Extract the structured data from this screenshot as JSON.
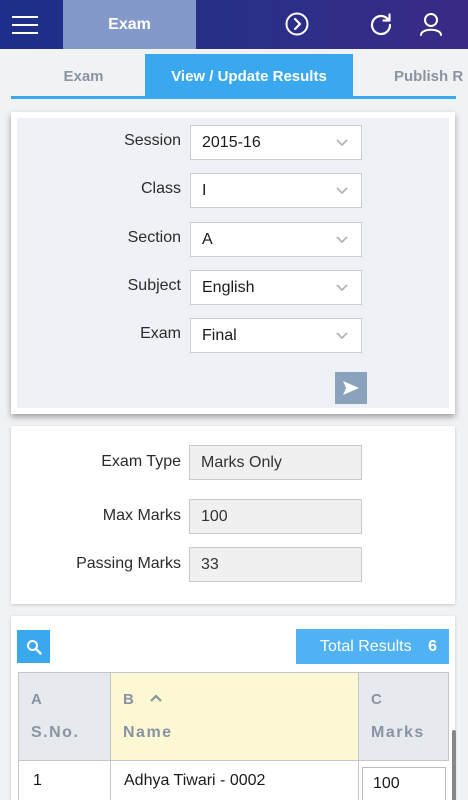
{
  "header": {
    "title": "Exam",
    "icons": [
      "menu-icon",
      "forward-circle-icon",
      "refresh-icon",
      "user-icon"
    ]
  },
  "tabs": [
    {
      "label": "Exam",
      "active": false
    },
    {
      "label": "View / Update Results",
      "active": true
    },
    {
      "label": "Publish R",
      "active": false
    }
  ],
  "filters": {
    "session": {
      "label": "Session",
      "value": "2015-16"
    },
    "class": {
      "label": "Class",
      "value": "I"
    },
    "section": {
      "label": "Section",
      "value": "A"
    },
    "subject": {
      "label": "Subject",
      "value": "English"
    },
    "exam": {
      "label": "Exam",
      "value": "Final"
    }
  },
  "exam_info": {
    "exam_type": {
      "label": "Exam Type",
      "value": "Marks Only"
    },
    "max_marks": {
      "label": "Max Marks",
      "value": "100"
    },
    "passing_marks": {
      "label": "Passing Marks",
      "value": "33"
    }
  },
  "results": {
    "total_label": "Total Results",
    "total_count": "6",
    "columns": [
      {
        "letter": "A",
        "name": "S.No."
      },
      {
        "letter": "B",
        "name": "Name"
      },
      {
        "letter": "C",
        "name": "Marks"
      }
    ],
    "rows": [
      {
        "sno": "1",
        "name": "Adhya Tiwari - 0002",
        "marks": "100"
      }
    ]
  },
  "colors": {
    "header_bg": "#2a2f88",
    "accent": "#3aa8ef",
    "active_tab": "#3aa8ef",
    "sorted_column": "#fdf8d4"
  }
}
